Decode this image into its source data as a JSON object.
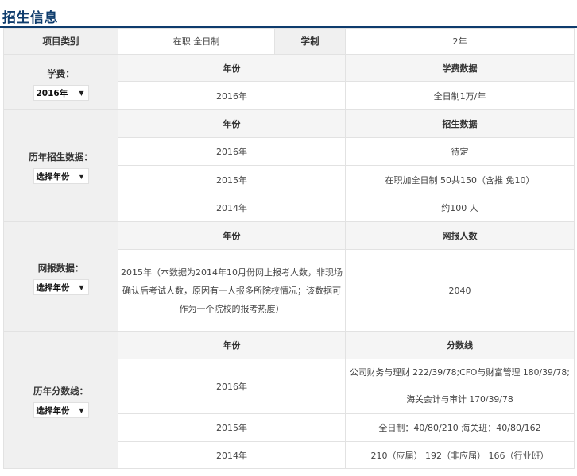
{
  "section_title": "招生信息",
  "overview": {
    "category_label": "项目类别",
    "category_value": "在职 全日制",
    "duration_label": "学制",
    "duration_value": "2年"
  },
  "tuition": {
    "label": "学费：",
    "select": "2016年",
    "col_year": "年份",
    "col_data": "学费数据",
    "rows": [
      {
        "year": "2016年",
        "value": "全日制1万/年"
      }
    ]
  },
  "enrollment": {
    "label": "历年招生数据：",
    "select": "选择年份",
    "col_year": "年份",
    "col_data": "招生数据",
    "rows": [
      {
        "year": "2016年",
        "value": "待定"
      },
      {
        "year": "2015年",
        "value": "在职加全日制 50共150（含推 免10）"
      },
      {
        "year": "2014年",
        "value": "约100 人"
      }
    ]
  },
  "online": {
    "label": "网报数据：",
    "select": "选择年份",
    "col_year": "年份",
    "col_data": "网报人数",
    "note": "2015年（本数据为2014年10月份网上报考人数，非现场确认后考试人数，原因有一人报多所院校情况；该数据可作为一个院校的报考热度）",
    "value": "2040"
  },
  "scores": {
    "label": "历年分数线：",
    "select": "选择年份",
    "col_year": "年份",
    "col_data": "分数线",
    "rows": [
      {
        "year": "2016年",
        "line1": "公司财务与理财 222/39/78;CFO与财富管理 180/39/78;",
        "line2": "海关会计与审计 170/39/78"
      },
      {
        "year": "2015年",
        "value": "全日制：40/80/210 海关班：40/80/162"
      },
      {
        "year": "2014年",
        "value": "210（应届） 192（非应届） 166（行业班）"
      }
    ]
  },
  "icons": {
    "dropdown": "triangle-down-icon"
  }
}
